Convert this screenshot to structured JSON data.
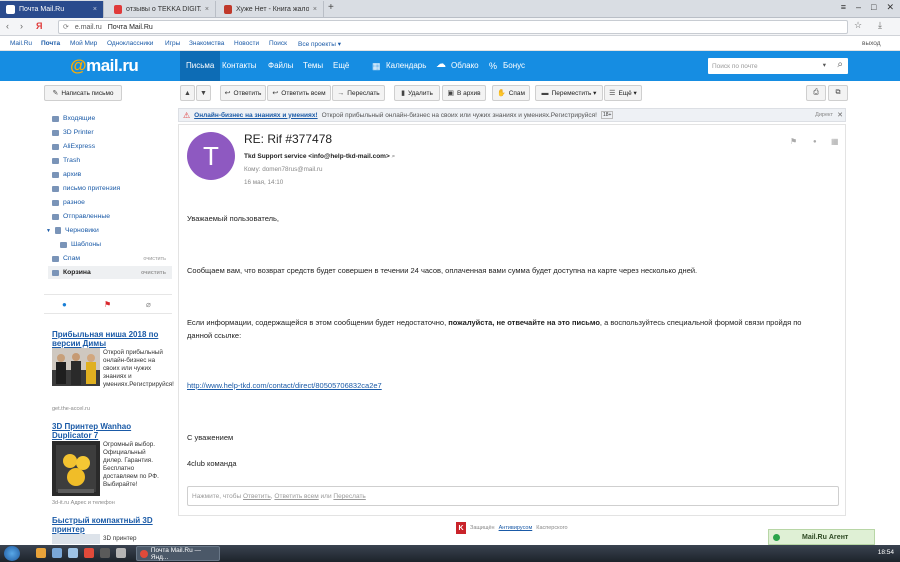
{
  "browser": {
    "tabs": [
      {
        "label": "Почта Mail.Ru",
        "active": true,
        "color": "#2a4b8d"
      },
      {
        "label": "отзывы о TEKKA DIGITAL S.",
        "active": false,
        "color": "#e03a3a"
      },
      {
        "label": "Хуже Нет - Книга жалоб, О",
        "active": false,
        "color": "#c0392b"
      }
    ],
    "new_tab": "+",
    "url_host": "e.mail.ru",
    "url_title": "Почта Mail.Ru"
  },
  "portal": {
    "links": [
      "Mail.Ru",
      "Почта",
      "Мой Мир",
      "Одноклассники",
      "Игры",
      "Знакомства",
      "Новости",
      "Поиск",
      "Все проекты ▾"
    ],
    "logout": "выход"
  },
  "header": {
    "logo_at": "@",
    "logo_text": "mail.ru",
    "nav": [
      "Письма",
      "Контакты",
      "Файлы",
      "Темы",
      "Ещё"
    ],
    "calendar": "Календарь",
    "cloud": "Облако",
    "bonus": "Бонус",
    "search_placeholder": "Поиск по почте",
    "accent": "#168de2"
  },
  "toolbar": {
    "compose": "Написать письмо",
    "reply": "Ответить",
    "reply_all": "Ответить всем",
    "forward": "Переслать",
    "delete": "Удалить",
    "archive": "В архив",
    "spam": "Спам",
    "move": "Переместить ▾",
    "more": "Ещё ▾"
  },
  "sidebar": {
    "folders": [
      {
        "label": "Входящие"
      },
      {
        "label": "3D Printer"
      },
      {
        "label": "AliExpress"
      },
      {
        "label": "Trash"
      },
      {
        "label": "архив"
      },
      {
        "label": "письмо притензия"
      },
      {
        "label": "разное"
      },
      {
        "label": "Отправленные"
      },
      {
        "label": "Черновики"
      },
      {
        "label": "Шаблоны"
      },
      {
        "label": "Спам",
        "action": "очистить"
      },
      {
        "label": "Корзина",
        "action": "очистить"
      }
    ]
  },
  "ads": [
    {
      "title": "Прибыльная ниша 2018 по версии Димы",
      "text": "Открой прибыльный онлайн-бизнес на своих или чужих знаниях и умениях.Регистрируйся!",
      "source": "get.the-accel.ru"
    },
    {
      "title": "3D Принтер Wanhao Duplicator 7",
      "text": "Огромный выбор. Официальный дилер. Гарантия. Бесплатно доставляем по РФ. Выбирайте!",
      "source": "3d-it.ru   Адрес и телефон"
    },
    {
      "title": "Быстрый компактный 3D принтер",
      "text": "3D принтер",
      "source": ""
    }
  ],
  "banner": {
    "title": "Онлайн-бизнес на знаниях и умениях!",
    "text": "Открой прибыльный онлайн-бизнес на своих или чужих знаниях и умениях.Регистрируйся!",
    "age": "18+",
    "direct": "Директ"
  },
  "message": {
    "avatar_letter": "T",
    "subject": "RE: Rif #377478",
    "from": "Tkd Support service <info@help-tkd-mail.com>",
    "to": "Кому:  domen78rus@mail.ru",
    "date": "16 мая, 14:10",
    "greeting": "Уважаемый пользователь,",
    "p1": "Сообщаем вам, что возврат средств будет совершен в течении 24 часов, оплаченная вами сумма будет доступна на карте через несколько дней.",
    "p2_start": "Если информации, содержащейся в этом сообщении будет недостаточно, ",
    "p2_bold": "пожалуйста, не отвечайте на это письмо",
    "p2_end": ", а воспользуйтесь специальной формой связи пройдя по",
    "p2_line2": "данной ссылке:",
    "link": "http://www.help-tkd.com/contact/direct/80505706832ca2e7",
    "regards": "С уважением",
    "signature": "4club команда"
  },
  "reply_box": {
    "prefix": "Нажмите, чтобы ",
    "reply": "Ответить",
    "sep1": ", ",
    "reply_all": "Ответить всем",
    "sep2": " или ",
    "forward": "Переслать"
  },
  "footer": {
    "protected_by": "Защищён",
    "antivirus": "Антивирусом",
    "vendor": "Касперского"
  },
  "agent": {
    "label": "Mail.Ru Агент"
  },
  "taskbar": {
    "task": "Почта Mail.Ru — Янд...",
    "clock": "18:54"
  }
}
